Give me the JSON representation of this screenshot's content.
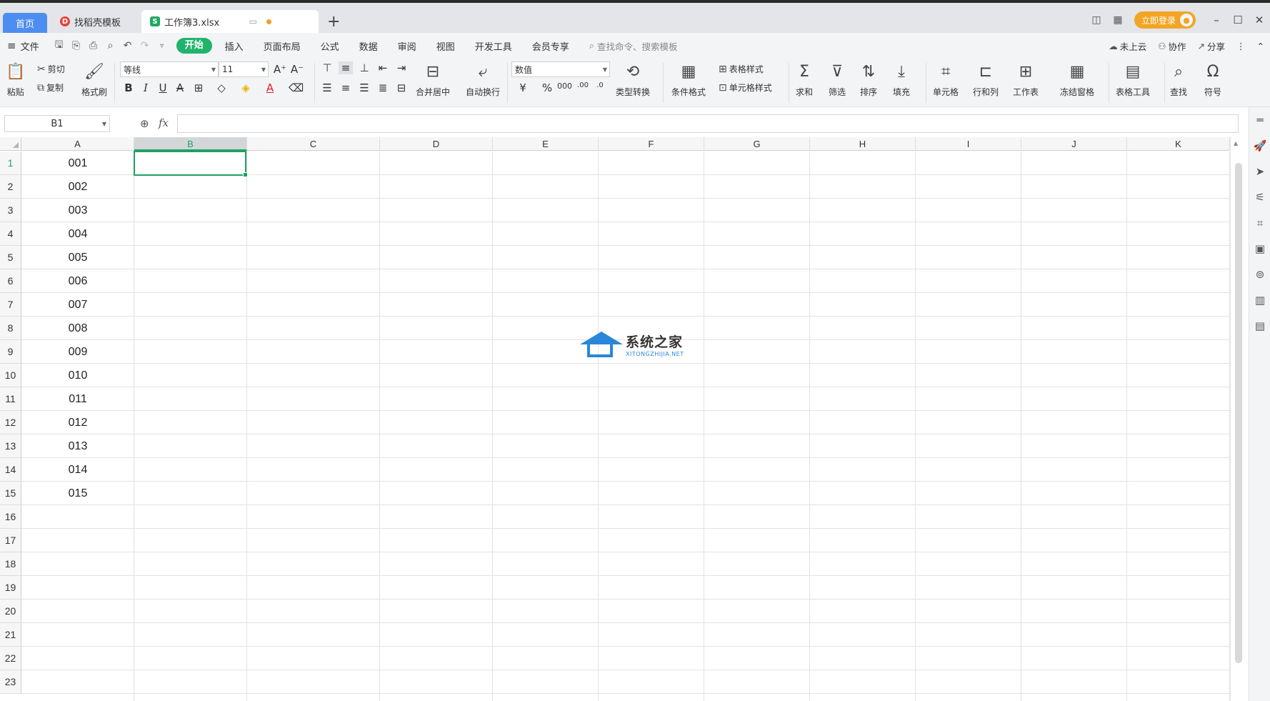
{
  "tabs": {
    "home": "首页",
    "template": "找稻壳模板",
    "document": "工作簿3.xlsx",
    "add": "+"
  },
  "titlebar": {
    "login": "立即登录"
  },
  "menu": {
    "file": "文件",
    "tabs": [
      "开始",
      "插入",
      "页面布局",
      "公式",
      "数据",
      "审阅",
      "视图",
      "开发工具",
      "会员专享"
    ],
    "search_placeholder": "查找命令、搜索模板",
    "cloud": "未上云",
    "collab": "协作",
    "share": "分享"
  },
  "ribbon": {
    "paste": "粘贴",
    "cut": "剪切",
    "copy": "复制",
    "format_painter": "格式刷",
    "font_name": "等线",
    "font_size": "11",
    "merge_center": "合并居中",
    "auto_wrap": "自动换行",
    "number_format": "数值",
    "type_convert": "类型转换",
    "conditional_format": "条件格式",
    "table_style": "表格样式",
    "cell_style": "单元格样式",
    "sum": "求和",
    "filter": "筛选",
    "sort": "排序",
    "fill": "填充",
    "cell": "单元格",
    "row_col": "行和列",
    "worksheet": "工作表",
    "freeze": "冻结窗格",
    "table_tools": "表格工具",
    "find": "查找",
    "symbol": "符号"
  },
  "formula_bar": {
    "name_box": "B1",
    "fx": "fx",
    "content": ""
  },
  "sheet": {
    "columns": [
      "A",
      "B",
      "C",
      "D",
      "E",
      "F",
      "G",
      "H",
      "I",
      "J",
      "K"
    ],
    "selected_column": "B",
    "selected_row": "1",
    "rows": [
      "1",
      "2",
      "3",
      "4",
      "5",
      "6",
      "7",
      "8",
      "9",
      "10",
      "11",
      "12",
      "13",
      "14",
      "15",
      "16",
      "17",
      "18",
      "19",
      "20",
      "21",
      "22",
      "23"
    ],
    "column_a_values": [
      "001",
      "002",
      "003",
      "004",
      "005",
      "006",
      "007",
      "008",
      "009",
      "010",
      "011",
      "012",
      "013",
      "014",
      "015"
    ]
  },
  "watermark": {
    "name": "系统之家",
    "url": "XITONGZHIJIA.NET"
  },
  "colors": {
    "accent_green": "#21b36b",
    "home_tab_blue": "#4d8df0",
    "login_orange": "#f2a524",
    "selection_green": "#1ea062"
  }
}
